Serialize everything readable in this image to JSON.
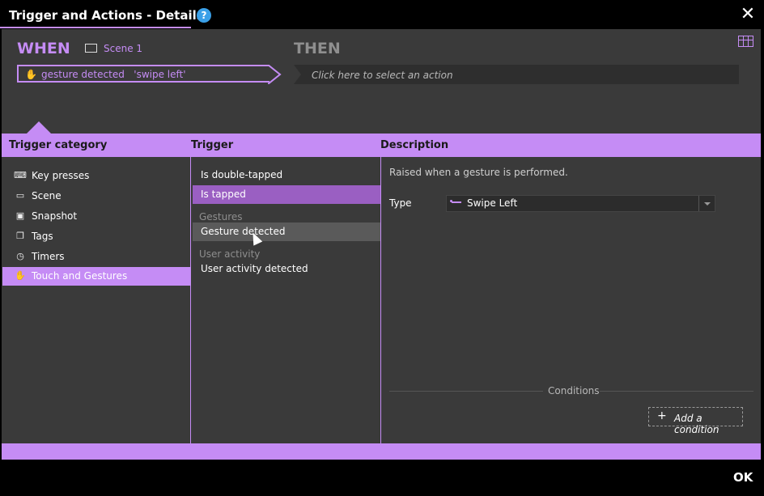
{
  "window": {
    "title": "Trigger and Actions - Details",
    "help_glyph": "?",
    "close_glyph": "✕",
    "ok_label": "OK"
  },
  "when": {
    "label": "WHEN",
    "scene_label": "Scene 1",
    "trigger_name": "gesture detected",
    "trigger_value": "'swipe left'"
  },
  "then": {
    "label": "THEN",
    "action_placeholder": "Click here to select an action"
  },
  "headers": {
    "category": "Trigger category",
    "trigger": "Trigger",
    "description": "Description"
  },
  "categories": [
    {
      "label": "Key presses",
      "icon": "keyboard-icon"
    },
    {
      "label": "Scene",
      "icon": "scene-icon"
    },
    {
      "label": "Snapshot",
      "icon": "snapshot-icon"
    },
    {
      "label": "Tags",
      "icon": "tags-icon"
    },
    {
      "label": "Timers",
      "icon": "timer-icon"
    },
    {
      "label": "Touch and Gestures",
      "icon": "hand-icon",
      "selected": true
    }
  ],
  "triggers": {
    "items_top": [
      "Is double-tapped",
      "Is tapped"
    ],
    "group_gestures": "Gestures",
    "gesture_item": "Gesture detected",
    "group_user_activity": "User activity",
    "user_activity_item": "User activity detected"
  },
  "description": {
    "text": "Raised when a gesture is performed.",
    "type_label": "Type",
    "type_value": "Swipe Left",
    "conditions_label": "Conditions",
    "add_condition_label": "Add a condition",
    "add_glyph": "+"
  },
  "colors": {
    "accent": "#c58cf5",
    "selected_trigger": "#9a5fc2",
    "panel": "#3a3a3a"
  }
}
